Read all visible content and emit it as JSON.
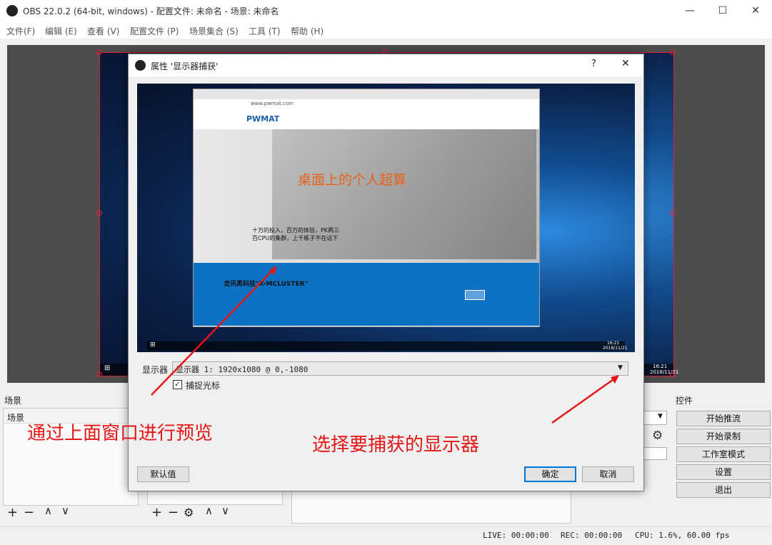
{
  "window": {
    "title": "OBS 22.0.2 (64-bit, windows) - 配置文件: 未命名 - 场景: 未命名",
    "minimize": "—",
    "maximize": "☐",
    "close": "✕"
  },
  "menu": [
    "文件(F)",
    "编辑 (E)",
    "查看 (V)",
    "配置文件 (P)",
    "场景集合 (S)",
    "工具 (T)",
    "帮助 (H)"
  ],
  "panels": {
    "scenes_header": "场景",
    "scenes_list_header": "场景",
    "controls_header": "控件"
  },
  "controls": [
    "开始推流",
    "开始录制",
    "工作室模式",
    "设置",
    "退出"
  ],
  "status": {
    "live": "LIVE: 00:00:00",
    "rec": "REC: 00:00:00",
    "cpu": "CPU: 1.6%, 60.00 fps"
  },
  "desktop_clock": {
    "time": "16:21",
    "date": "2018/11/21"
  },
  "dialog": {
    "title": "属性 '显示器捕获'",
    "help": "?",
    "close": "✕",
    "display_label": "显示器",
    "display_value": "显示器 1: 1920x1080 @ 0,-1080",
    "capture_cursor_label": "捕捉光标",
    "capture_cursor_checked": true,
    "defaults_button": "默认值",
    "ok_button": "确定",
    "cancel_button": "取消"
  },
  "preview_site": {
    "logo": "PWMAT",
    "headline": "桌面上的个人超算",
    "subtext_1": "十万的投入，百万的体验，PK两三",
    "subtext_2": "百CPU的集群，上千瓶子不在话下",
    "banner_title": "龙讯黑科技\"X-MCLUSTER\"",
    "url": "www.pwmat.com",
    "taskbar_time": "16:21",
    "taskbar_date": "2018/11/21"
  },
  "annotations": {
    "left": "通过上面窗口进行预览",
    "right": "选择要捕获的显示器"
  },
  "colors": {
    "accent": "#0078d7",
    "annotation": "#e41616",
    "selection_border": "#dd2233"
  }
}
